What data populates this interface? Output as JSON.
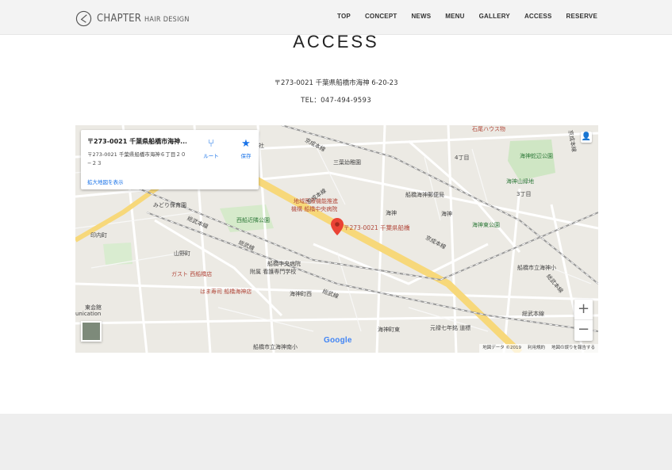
{
  "header": {
    "logo_main": "CHAPTER",
    "logo_sub": "HAIR DESIGN",
    "nav": [
      "TOP",
      "CONCEPT",
      "NEWS",
      "MENU",
      "GALLERY",
      "ACCESS",
      "RESERVE"
    ]
  },
  "page": {
    "title": "ACCESS",
    "address": "〒273-0021 千葉県船橋市海神 6-20-23",
    "tel": "TEL：047-494-9593"
  },
  "map": {
    "info_title": "〒273-0021 千葉県船橋市海神...",
    "info_address": "〒273-0021 千葉県船橋市海神６丁目２０−２３",
    "route_label": "ルート",
    "save_label": "保存",
    "larger_map_link": "拡大地図を表示",
    "pin_label": "〒273-0021 千葉県船橋",
    "zoom_in": "+",
    "zoom_out": "−",
    "google_logo": "Google",
    "attribution": [
      "地図データ ©2019",
      "利用規約",
      "地図の誤りを報告する"
    ],
    "labels": {
      "l1": "浅間神社",
      "l2": "京成本線",
      "l3": "三葉幼稚園",
      "l4": "4丁目",
      "l5": "海神蛇辺公園",
      "l6": "海神山緑地",
      "l7": "3丁目",
      "l8": "地域医療機能推進",
      "l9": "機構 船橋中央病院",
      "l10": "船橋海神郵便局",
      "l11": "海神",
      "l12": "海神",
      "l13": "海神東公園",
      "l14": "みどり保育園",
      "l15": "西船近隣公園",
      "l16": "印内町",
      "l17": "総武本線",
      "l18": "山野町",
      "l19": "総武線",
      "l20": "船橋中央病院",
      "l21": "附属 看護専門学校",
      "l22": "ガスト 西船橋店",
      "l23": "はま寿司 船橋海神店",
      "l24": "海神町西",
      "l25": "総武線",
      "l26": "京成本線",
      "l27": "船橋市立海神小",
      "l28": "総武本線",
      "l29": "総武本線",
      "l30": "海神町東",
      "l31": "元禄七年銘 道標",
      "l32": "船橋市立海神南小",
      "l33": "東会館",
      "l34": "unication",
      "l35": "石尾ハウス物",
      "l36": "京成本線",
      "l37": "京成本線"
    }
  },
  "colors": {
    "header_bg": "#f3f3f3",
    "footer_bg": "#eeeeee",
    "pin_red": "#ea4335",
    "road_yellow": "#f7d87a",
    "park_green": "#cfe6c4",
    "link_blue": "#1a73e8"
  }
}
